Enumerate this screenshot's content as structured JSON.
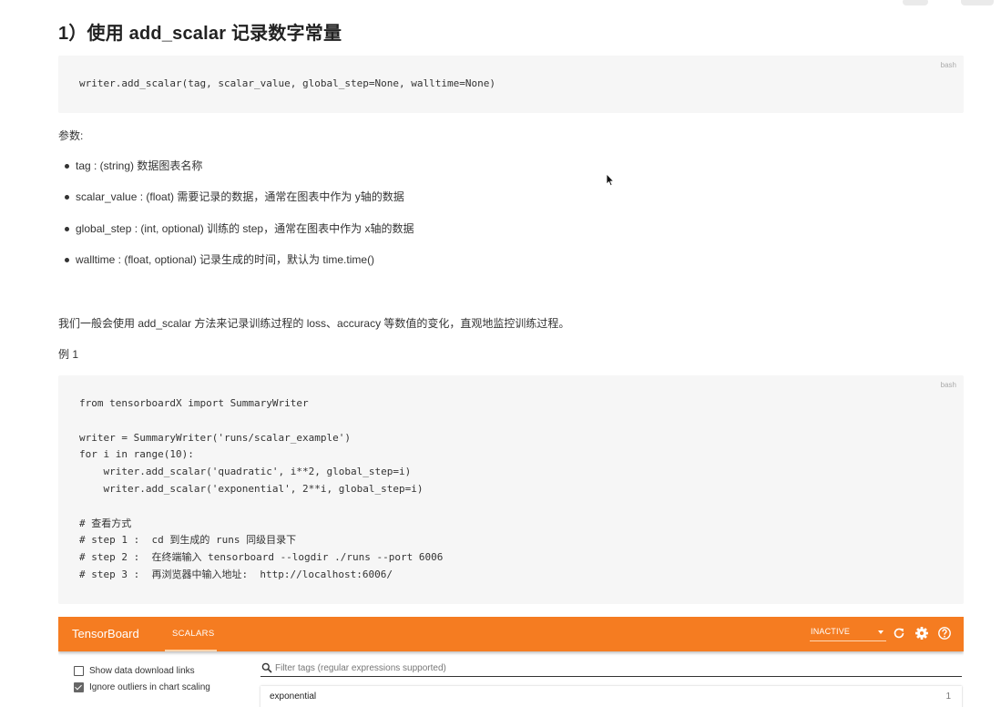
{
  "article": {
    "heading": "1）使用 add_scalar 记录数字常量",
    "code1": {
      "lang": "bash",
      "lines": [
        "writer.add_scalar(tag, scalar_value, global_step=None, walltime=None)"
      ]
    },
    "params_label": "参数:",
    "params": [
      "tag : (string) 数据图表名称",
      "scalar_value : (float) 需要记录的数据，通常在图表中作为 y轴的数据",
      "global_step : (int, optional) 训练的 step，通常在图表中作为 x轴的数据",
      "walltime : (float, optional) 记录生成的时间，默认为 time.time()"
    ],
    "description": "我们一般会使用 add_scalar 方法来记录训练过程的 loss、accuracy 等数值的变化，直观地监控训练过程。",
    "example_label": "例 1",
    "code2": {
      "lang": "bash",
      "lines": [
        "from tensorboardX import SummaryWriter",
        "",
        "writer = SummaryWriter('runs/scalar_example')",
        "for i in range(10):",
        "    writer.add_scalar('quadratic', i**2, global_step=i)",
        "    writer.add_scalar('exponential', 2**i, global_step=i)",
        "",
        "# 查看方式",
        "# step 1 :  cd 到生成的 runs 同级目录下",
        "# step 2 :  在终端输入 tensorboard --logdir ./runs --port 6006",
        "# step 3 :  再浏览器中输入地址:  http://localhost:6006/"
      ]
    }
  },
  "tensorboard": {
    "brand": "TensorBoard",
    "tab": "SCALARS",
    "status_select": "INACTIVE",
    "icons": [
      "refresh-icon",
      "settings-icon",
      "help-icon"
    ],
    "bar_color": "#f57c21",
    "checkboxes": [
      {
        "label": "Show data download links",
        "checked": false
      },
      {
        "label": "Ignore outliers in chart scaling",
        "checked": true
      }
    ],
    "search_placeholder": "Filter tags (regular expressions supported)",
    "tag_card": {
      "name": "exponential",
      "count": "1"
    }
  }
}
